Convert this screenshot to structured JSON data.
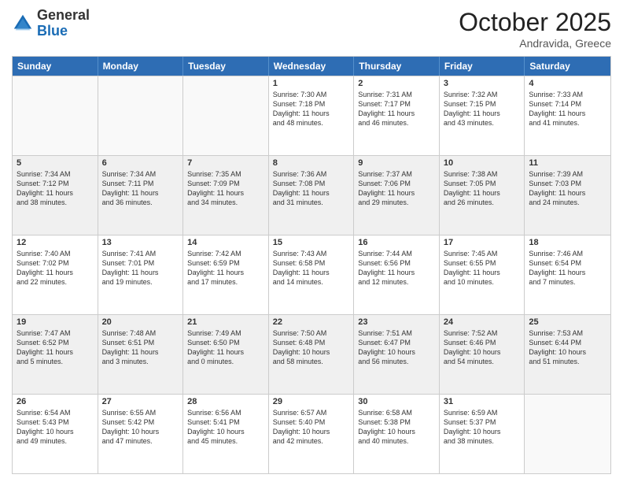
{
  "header": {
    "logo_general": "General",
    "logo_blue": "Blue",
    "month": "October 2025",
    "location": "Andravida, Greece"
  },
  "days_of_week": [
    "Sunday",
    "Monday",
    "Tuesday",
    "Wednesday",
    "Thursday",
    "Friday",
    "Saturday"
  ],
  "weeks": [
    [
      {
        "day": "",
        "info": ""
      },
      {
        "day": "",
        "info": ""
      },
      {
        "day": "",
        "info": ""
      },
      {
        "day": "1",
        "info": "Sunrise: 7:30 AM\nSunset: 7:18 PM\nDaylight: 11 hours\nand 48 minutes."
      },
      {
        "day": "2",
        "info": "Sunrise: 7:31 AM\nSunset: 7:17 PM\nDaylight: 11 hours\nand 46 minutes."
      },
      {
        "day": "3",
        "info": "Sunrise: 7:32 AM\nSunset: 7:15 PM\nDaylight: 11 hours\nand 43 minutes."
      },
      {
        "day": "4",
        "info": "Sunrise: 7:33 AM\nSunset: 7:14 PM\nDaylight: 11 hours\nand 41 minutes."
      }
    ],
    [
      {
        "day": "5",
        "info": "Sunrise: 7:34 AM\nSunset: 7:12 PM\nDaylight: 11 hours\nand 38 minutes."
      },
      {
        "day": "6",
        "info": "Sunrise: 7:34 AM\nSunset: 7:11 PM\nDaylight: 11 hours\nand 36 minutes."
      },
      {
        "day": "7",
        "info": "Sunrise: 7:35 AM\nSunset: 7:09 PM\nDaylight: 11 hours\nand 34 minutes."
      },
      {
        "day": "8",
        "info": "Sunrise: 7:36 AM\nSunset: 7:08 PM\nDaylight: 11 hours\nand 31 minutes."
      },
      {
        "day": "9",
        "info": "Sunrise: 7:37 AM\nSunset: 7:06 PM\nDaylight: 11 hours\nand 29 minutes."
      },
      {
        "day": "10",
        "info": "Sunrise: 7:38 AM\nSunset: 7:05 PM\nDaylight: 11 hours\nand 26 minutes."
      },
      {
        "day": "11",
        "info": "Sunrise: 7:39 AM\nSunset: 7:03 PM\nDaylight: 11 hours\nand 24 minutes."
      }
    ],
    [
      {
        "day": "12",
        "info": "Sunrise: 7:40 AM\nSunset: 7:02 PM\nDaylight: 11 hours\nand 22 minutes."
      },
      {
        "day": "13",
        "info": "Sunrise: 7:41 AM\nSunset: 7:01 PM\nDaylight: 11 hours\nand 19 minutes."
      },
      {
        "day": "14",
        "info": "Sunrise: 7:42 AM\nSunset: 6:59 PM\nDaylight: 11 hours\nand 17 minutes."
      },
      {
        "day": "15",
        "info": "Sunrise: 7:43 AM\nSunset: 6:58 PM\nDaylight: 11 hours\nand 14 minutes."
      },
      {
        "day": "16",
        "info": "Sunrise: 7:44 AM\nSunset: 6:56 PM\nDaylight: 11 hours\nand 12 minutes."
      },
      {
        "day": "17",
        "info": "Sunrise: 7:45 AM\nSunset: 6:55 PM\nDaylight: 11 hours\nand 10 minutes."
      },
      {
        "day": "18",
        "info": "Sunrise: 7:46 AM\nSunset: 6:54 PM\nDaylight: 11 hours\nand 7 minutes."
      }
    ],
    [
      {
        "day": "19",
        "info": "Sunrise: 7:47 AM\nSunset: 6:52 PM\nDaylight: 11 hours\nand 5 minutes."
      },
      {
        "day": "20",
        "info": "Sunrise: 7:48 AM\nSunset: 6:51 PM\nDaylight: 11 hours\nand 3 minutes."
      },
      {
        "day": "21",
        "info": "Sunrise: 7:49 AM\nSunset: 6:50 PM\nDaylight: 11 hours\nand 0 minutes."
      },
      {
        "day": "22",
        "info": "Sunrise: 7:50 AM\nSunset: 6:48 PM\nDaylight: 10 hours\nand 58 minutes."
      },
      {
        "day": "23",
        "info": "Sunrise: 7:51 AM\nSunset: 6:47 PM\nDaylight: 10 hours\nand 56 minutes."
      },
      {
        "day": "24",
        "info": "Sunrise: 7:52 AM\nSunset: 6:46 PM\nDaylight: 10 hours\nand 54 minutes."
      },
      {
        "day": "25",
        "info": "Sunrise: 7:53 AM\nSunset: 6:44 PM\nDaylight: 10 hours\nand 51 minutes."
      }
    ],
    [
      {
        "day": "26",
        "info": "Sunrise: 6:54 AM\nSunset: 5:43 PM\nDaylight: 10 hours\nand 49 minutes."
      },
      {
        "day": "27",
        "info": "Sunrise: 6:55 AM\nSunset: 5:42 PM\nDaylight: 10 hours\nand 47 minutes."
      },
      {
        "day": "28",
        "info": "Sunrise: 6:56 AM\nSunset: 5:41 PM\nDaylight: 10 hours\nand 45 minutes."
      },
      {
        "day": "29",
        "info": "Sunrise: 6:57 AM\nSunset: 5:40 PM\nDaylight: 10 hours\nand 42 minutes."
      },
      {
        "day": "30",
        "info": "Sunrise: 6:58 AM\nSunset: 5:38 PM\nDaylight: 10 hours\nand 40 minutes."
      },
      {
        "day": "31",
        "info": "Sunrise: 6:59 AM\nSunset: 5:37 PM\nDaylight: 10 hours\nand 38 minutes."
      },
      {
        "day": "",
        "info": ""
      }
    ]
  ]
}
